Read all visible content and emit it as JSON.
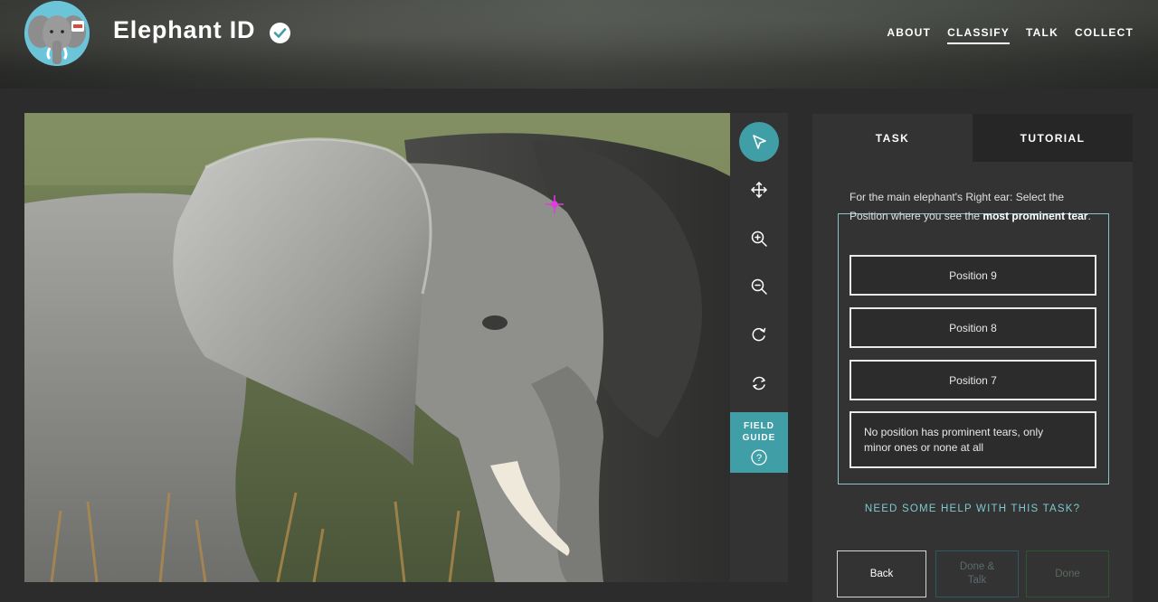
{
  "header": {
    "title": "Elephant ID",
    "nav": [
      "ABOUT",
      "CLASSIFY",
      "TALK",
      "COLLECT"
    ],
    "active_nav": "CLASSIFY"
  },
  "toolbar": {
    "tools": [
      "pointer-icon",
      "move-icon",
      "zoom-in-icon",
      "zoom-out-icon",
      "rotate-icon",
      "reset-icon"
    ],
    "active_tool": "pointer-icon",
    "field_guide_label": "FIELD\nGUIDE"
  },
  "task": {
    "tabs": [
      "TASK",
      "TUTORIAL"
    ],
    "active_tab": "TASK",
    "question_prefix": "For the main elephant's Right ear: Select the Position where you see the ",
    "question_emphasis": "most prominent tear",
    "question_suffix": ".",
    "answers": [
      "Position 9",
      "Position 8",
      "Position 7",
      "No position has prominent tears, only minor ones or none at all"
    ],
    "help_link": "NEED SOME HELP WITH THIS TASK?",
    "buttons": {
      "back": "Back",
      "done_talk": "Done &\nTalk",
      "done": "Done"
    }
  },
  "colors": {
    "accent": "#3f9ea6",
    "panel": "#333333",
    "background": "#2c2c2c",
    "link": "#7ec9ce"
  }
}
